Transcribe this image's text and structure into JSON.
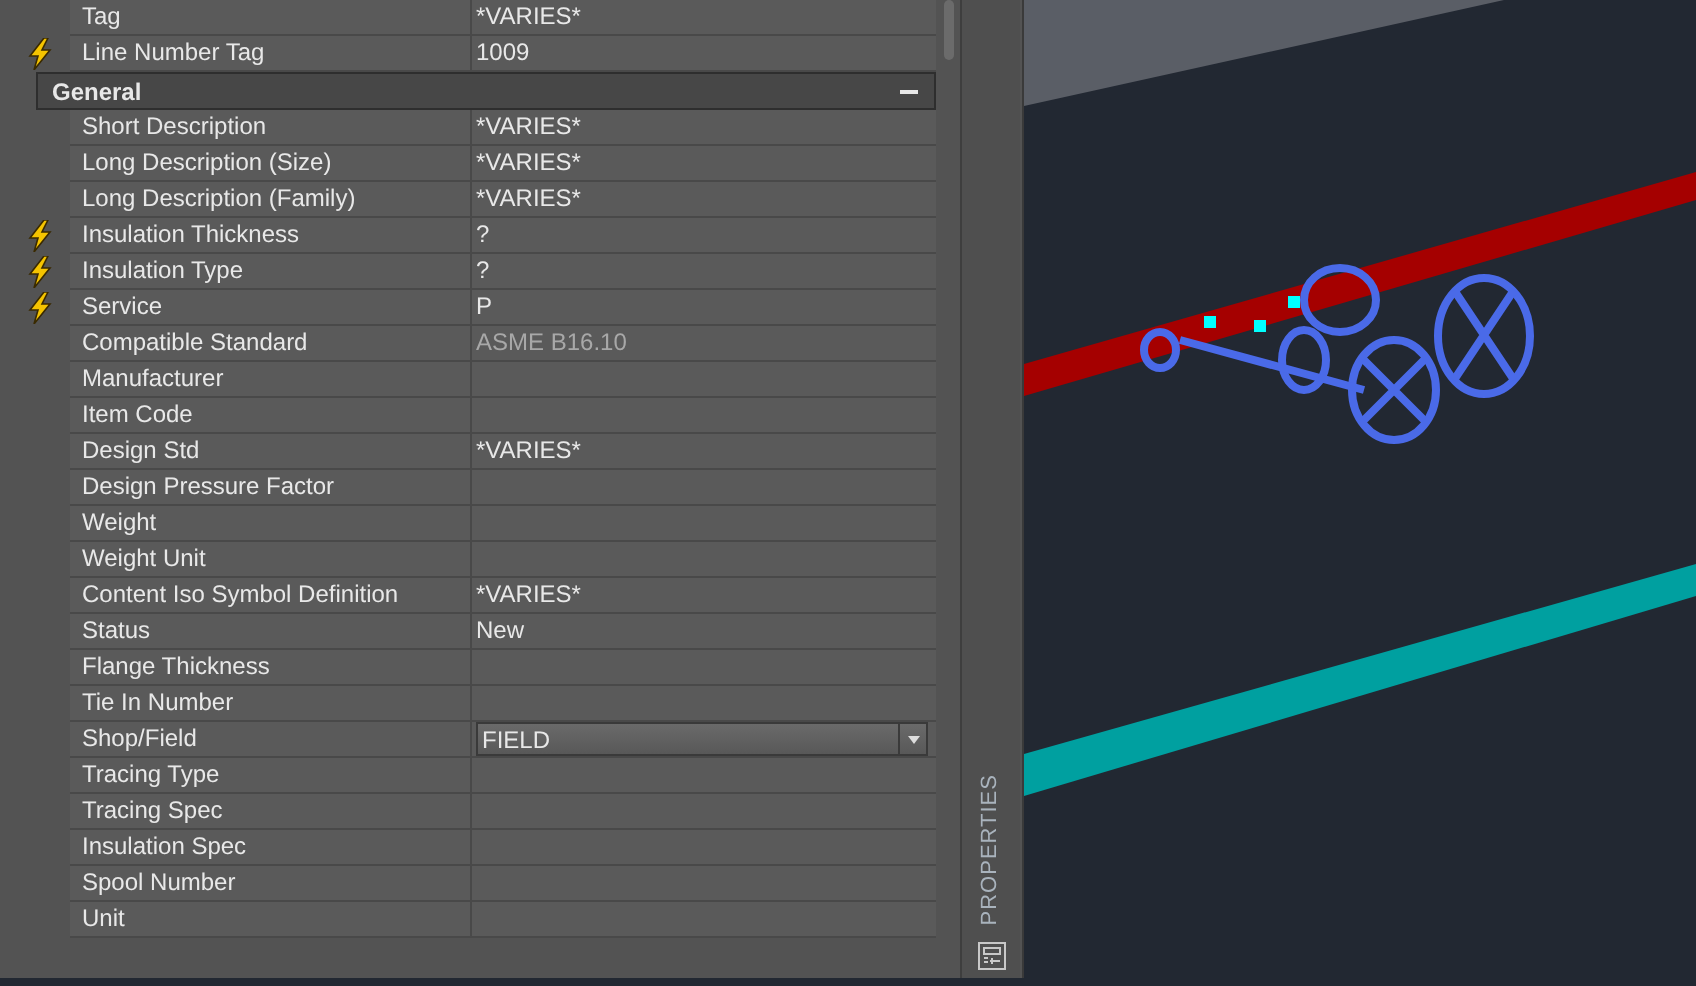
{
  "properties_panel": {
    "title": "PROPERTIES",
    "rows": [
      {
        "kind": "property",
        "label": "Tag",
        "value": "*VARIES*",
        "flagged": false
      },
      {
        "kind": "property",
        "label": "Line Number Tag",
        "value": "1009",
        "flagged": true
      },
      {
        "kind": "section",
        "label": "General",
        "expanded": true
      },
      {
        "kind": "property",
        "label": "Short Description",
        "value": "*VARIES*",
        "flagged": false
      },
      {
        "kind": "property",
        "label": "Long Description (Size)",
        "value": "*VARIES*",
        "flagged": false
      },
      {
        "kind": "property",
        "label": "Long Description (Family)",
        "value": "*VARIES*",
        "flagged": false
      },
      {
        "kind": "property",
        "label": "Insulation Thickness",
        "value": "?",
        "flagged": true
      },
      {
        "kind": "property",
        "label": "Insulation Type",
        "value": "?",
        "flagged": true
      },
      {
        "kind": "property",
        "label": "Service",
        "value": "P",
        "flagged": true
      },
      {
        "kind": "readonly",
        "label": "Compatible Standard",
        "value": "ASME B16.10",
        "flagged": false
      },
      {
        "kind": "property",
        "label": "Manufacturer",
        "flagged": false
      },
      {
        "kind": "property",
        "label": "Item Code",
        "flagged": false
      },
      {
        "kind": "property",
        "label": "Design Std",
        "value": "*VARIES*",
        "flagged": false
      },
      {
        "kind": "property",
        "label": "Design Pressure Factor",
        "flagged": false
      },
      {
        "kind": "property",
        "label": "Weight",
        "flagged": false
      },
      {
        "kind": "property",
        "label": "Weight Unit",
        "flagged": false
      },
      {
        "kind": "property",
        "label": "Content Iso Symbol Definition",
        "value": "*VARIES*",
        "flagged": false
      },
      {
        "kind": "property",
        "label": "Status",
        "value": "New",
        "flagged": false
      },
      {
        "kind": "property",
        "label": "Flange Thickness",
        "flagged": false
      },
      {
        "kind": "property",
        "label": "Tie In Number",
        "flagged": false
      },
      {
        "kind": "dropdown",
        "label": "Shop/Field",
        "value": "FIELD",
        "flagged": false
      },
      {
        "kind": "property",
        "label": "Tracing Type",
        "flagged": false
      },
      {
        "kind": "property",
        "label": "Tracing Spec",
        "flagged": false
      },
      {
        "kind": "property",
        "label": "Insulation Spec",
        "flagged": false
      },
      {
        "kind": "property",
        "label": "Spool Number",
        "flagged": false
      },
      {
        "kind": "property",
        "label": "Unit",
        "flagged": false
      }
    ]
  }
}
